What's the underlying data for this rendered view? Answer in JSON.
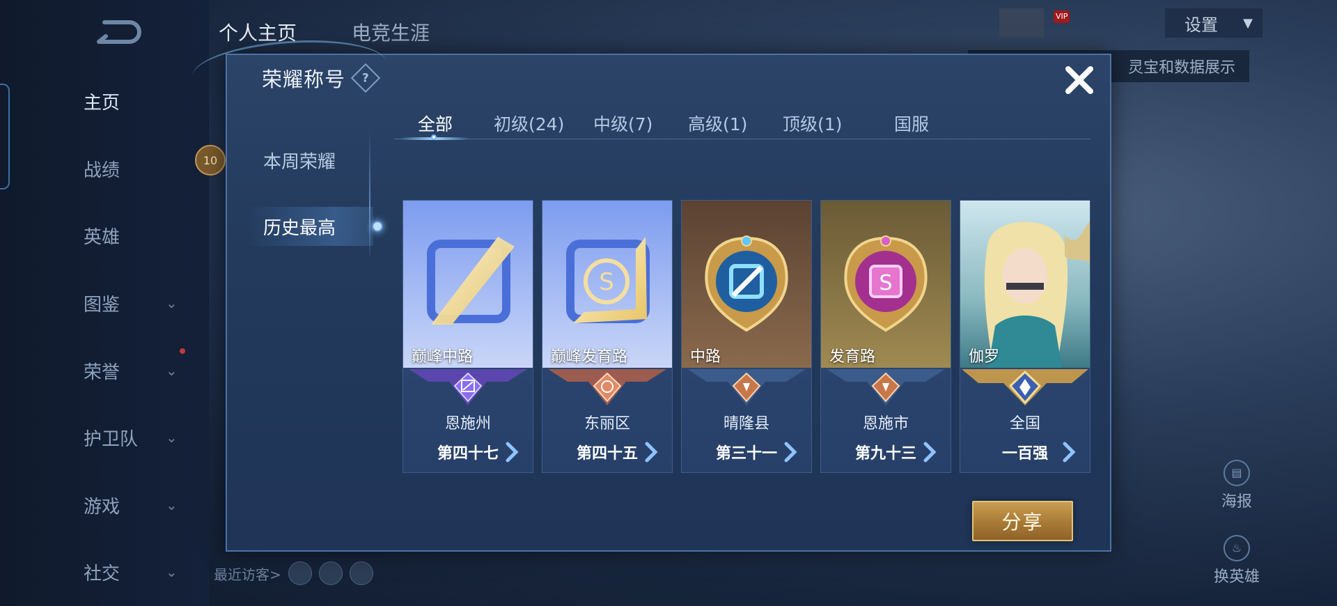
{
  "background": {
    "top_tabs": [
      "个人主页",
      "电竞生涯"
    ],
    "nav": [
      {
        "label": "主页",
        "chevron": false
      },
      {
        "label": "战绩",
        "chevron": false
      },
      {
        "label": "英雄",
        "chevron": false
      },
      {
        "label": "图鉴",
        "chevron": true
      },
      {
        "label": "荣誉",
        "chevron": true
      },
      {
        "label": "护卫队",
        "chevron": true
      },
      {
        "label": "游戏",
        "chevron": true
      },
      {
        "label": "社交",
        "chevron": true
      }
    ],
    "settings_label": "设置",
    "vip_badge": "VIP",
    "hint_text": "灵宝和数据展示",
    "poster_label": "海报",
    "change_hero_label": "换英雄",
    "recent_visitors": "最近访客>",
    "hero_level": "10"
  },
  "dialog": {
    "title": "荣耀称号",
    "help": "?",
    "side": [
      "本周荣耀",
      "历史最高"
    ],
    "tabs": [
      "全部",
      "初级(24)",
      "中级(7)",
      "高级(1)",
      "顶级(1)",
      "国服"
    ],
    "share_label": "分享"
  },
  "cards": [
    {
      "name": "巅峰中路",
      "region": "恩施州",
      "rank": "第四十七"
    },
    {
      "name": "巅峰发育路",
      "region": "东丽区",
      "rank": "第四十五"
    },
    {
      "name": "中路",
      "region": "晴隆县",
      "rank": "第三十一"
    },
    {
      "name": "发育路",
      "region": "恩施市",
      "rank": "第九十三"
    },
    {
      "name": "伽罗",
      "region": "全国",
      "rank": "一百强"
    }
  ],
  "colors": {
    "accent": "#9fd4ff",
    "gold": "#c99d52",
    "purple_emblem": "#7d5bd8",
    "bronze_emblem": "#c7774a"
  }
}
